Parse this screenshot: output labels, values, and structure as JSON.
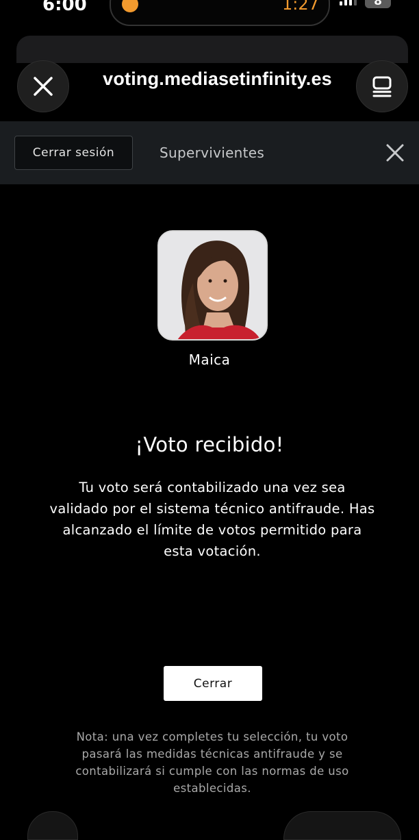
{
  "status_bar": {
    "time": "6:00",
    "island_time": "1:27",
    "battery": "8",
    "alarm_icon": "alarm-icon",
    "accent_color": "#f29a2e"
  },
  "browser": {
    "url": "voting.mediasetinfinity.es",
    "close_icon": "close-icon",
    "menu_icon": "tabs-icon"
  },
  "nav": {
    "logout_label": "Cerrar sesión",
    "title": "Supervivientes",
    "close_icon": "close-icon"
  },
  "candidate": {
    "name": "Maica"
  },
  "confirmation": {
    "title": "¡Voto recibido!",
    "message": "Tu voto será contabilizado una vez sea validado por el sistema técnico antifraude. Has alcanzado el límite de votos permitido para esta votación.",
    "button_label": "Cerrar"
  },
  "footer": {
    "note": "Nota: una vez completes tu selección, tu voto pasará las medidas técnicas antifraude y se contabilizará si cumple con las normas de uso establecidas."
  }
}
